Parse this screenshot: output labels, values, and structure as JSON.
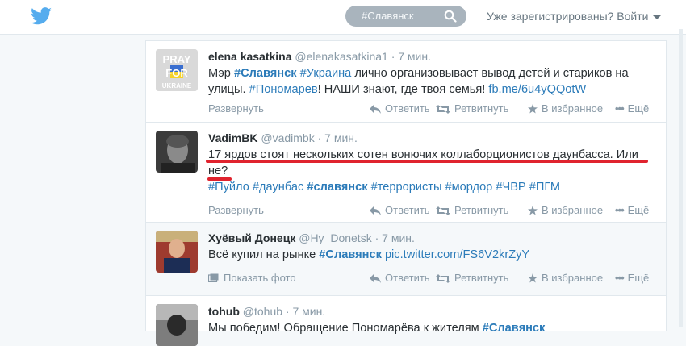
{
  "header": {
    "search_value": "#Славянск",
    "login_text": "Уже зарегистрированы? Войти"
  },
  "tweets": [
    {
      "name": "elena kasatkina",
      "handle": "@elenakasatkina1",
      "time": "· 7 мин.",
      "avatar_text": [
        "PRAY",
        "FOR",
        "UKRAINE"
      ],
      "text_parts": [
        {
          "t": "Мэр ",
          "kind": "plain"
        },
        {
          "t": "#Славянск",
          "kind": "hashbold"
        },
        {
          "t": " ",
          "kind": "plain"
        },
        {
          "t": "#Украина",
          "kind": "hash"
        },
        {
          "t": " лично организовывает вывод детей и стариков на улицы. ",
          "kind": "plain"
        },
        {
          "t": "#Пономарев",
          "kind": "hash"
        },
        {
          "t": "! НАШИ знают, где твоя семья! ",
          "kind": "plain"
        },
        {
          "t": "fb.me/6u4yQQotW",
          "kind": "hash"
        }
      ],
      "expand": "Развернуть"
    },
    {
      "name": "VadimBK",
      "handle": "@vadimbk",
      "time": "· 7 мин.",
      "text_parts": [
        {
          "t": "17 ярдов стоят нескольких сотен вонючих коллаборционистов даунбасса. Или не?",
          "kind": "plain"
        },
        {
          "t": " ",
          "kind": "plain"
        }
      ],
      "hashtags": [
        {
          "t": "#Пуйло",
          "kind": "hash"
        },
        {
          "t": " ",
          "kind": "plain"
        },
        {
          "t": "#даунбас",
          "kind": "hash"
        },
        {
          "t": " ",
          "kind": "plain"
        },
        {
          "t": "#славянск",
          "kind": "hashbold"
        },
        {
          "t": " ",
          "kind": "plain"
        },
        {
          "t": "#террористы",
          "kind": "hash"
        },
        {
          "t": " ",
          "kind": "plain"
        },
        {
          "t": "#мордор",
          "kind": "hash"
        },
        {
          "t": " ",
          "kind": "plain"
        },
        {
          "t": "#ЧВР",
          "kind": "hash"
        },
        {
          "t": " ",
          "kind": "plain"
        },
        {
          "t": "#ПГМ",
          "kind": "hash"
        }
      ],
      "expand": "Развернуть"
    },
    {
      "name": "Хуёвый Донецк",
      "handle": "@Hy_Donetsk",
      "time": "· 7 мин.",
      "text_parts": [
        {
          "t": "Всё купил на рынке ",
          "kind": "plain"
        },
        {
          "t": "#Славянск",
          "kind": "hashbold"
        },
        {
          "t": " ",
          "kind": "plain"
        },
        {
          "t": "pic.twitter.com/FS6V2krZyY",
          "kind": "hash"
        }
      ],
      "expand": "Показать фото"
    },
    {
      "name": "tohub",
      "handle": "@tohub",
      "time": "· 7 мин.",
      "text_parts": [
        {
          "t": "Мы победим! Обращение Пономарёва к жителям ",
          "kind": "plain"
        },
        {
          "t": "#Славянск",
          "kind": "hashbold"
        }
      ]
    }
  ],
  "actions": {
    "reply": "Ответить",
    "retweet": "Ретвитнуть",
    "favorite": "В избранное",
    "more": "Ещё"
  },
  "colors": {
    "link": "#2b7bb9",
    "red_annotation": "#e0232e",
    "twitter_blue": "#55acee"
  }
}
